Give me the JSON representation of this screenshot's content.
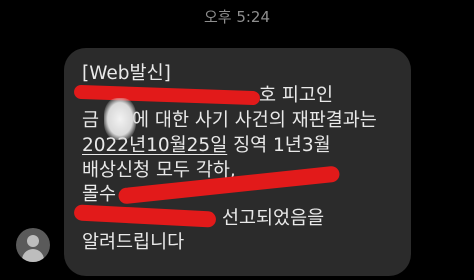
{
  "status": {
    "time": "오후 5:24"
  },
  "message": {
    "sender_tag": "[Web발신]",
    "line2_visible": "호 피고인",
    "line3_prefix": "금",
    "line3_suffix": "에 대한 사기 사건의 재판결과는",
    "line4_date": "2022년10월25일",
    "line4_rest": " 징역 1년3월",
    "line5": "배상신청 모두 각하,",
    "line6_prefix": "몰수",
    "line7_visible": "선고되었음을",
    "line8": "알려드립니다"
  },
  "colors": {
    "background": "#000000",
    "bubble": "#2b2b2b",
    "text": "#e9e9e9",
    "redaction": "#e21a1a"
  },
  "icons": {
    "avatar": "person-avatar-icon"
  }
}
